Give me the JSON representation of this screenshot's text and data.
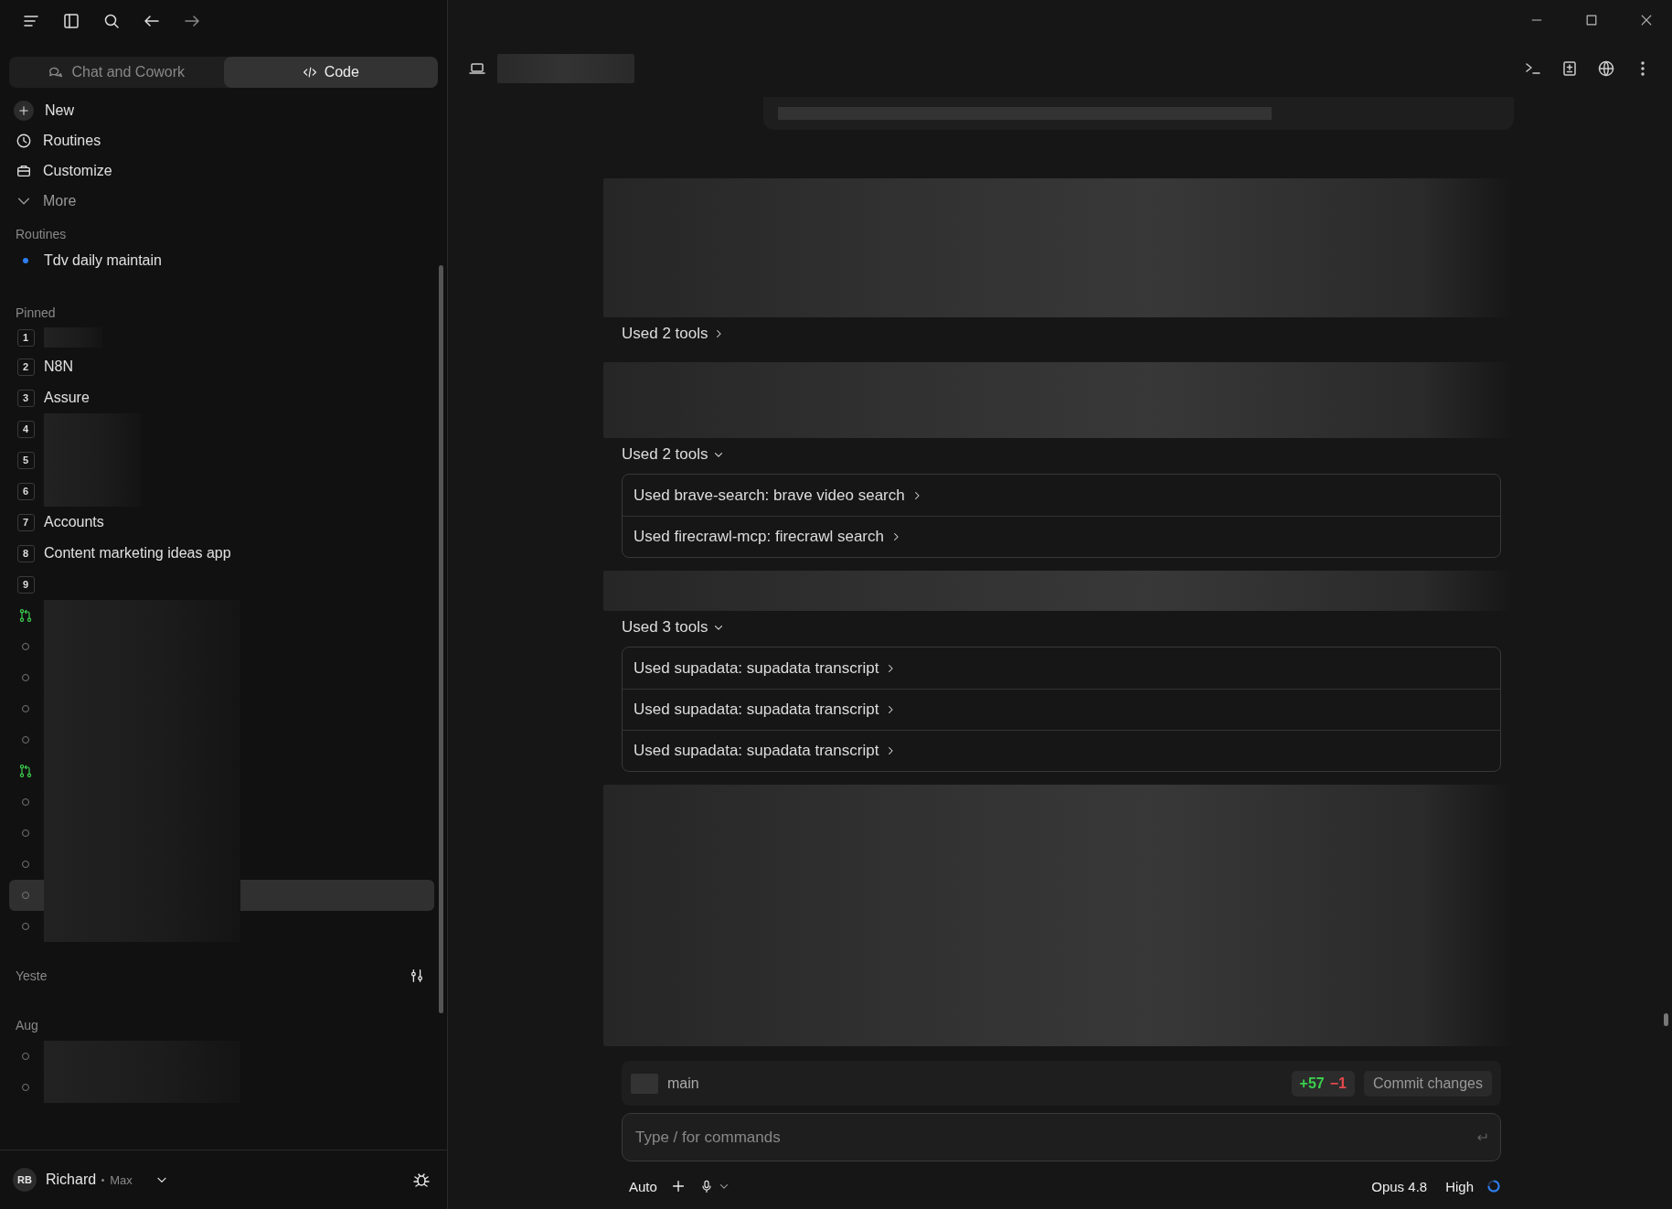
{
  "mode_tabs": [
    {
      "label": "Chat and Cowork",
      "kind": "chat",
      "selected": false
    },
    {
      "label": "Code",
      "kind": "code",
      "selected": true
    }
  ],
  "nav_items": [
    {
      "label": "New",
      "kind": "new"
    },
    {
      "label": "Routines",
      "kind": "routines"
    },
    {
      "label": "Customize",
      "kind": "customize"
    },
    {
      "label": "More",
      "kind": "more"
    }
  ],
  "routines": {
    "heading": "Routines",
    "items": [
      {
        "label": "Tdv daily maintain"
      }
    ]
  },
  "pinned": {
    "heading": "Pinned",
    "items": [
      {
        "number": "1"
      },
      {
        "number": "2",
        "label": "N8N"
      },
      {
        "number": "3",
        "label": "Assure"
      },
      {
        "number": "4"
      },
      {
        "number": "5"
      },
      {
        "number": "6"
      },
      {
        "number": "7",
        "label": "Accounts"
      },
      {
        "number": "8",
        "label": "Content marketing ideas app"
      },
      {
        "number": "9"
      }
    ]
  },
  "sessions": [
    {
      "kind": "pull-request",
      "selected": false
    },
    {
      "kind": "idle",
      "selected": false
    },
    {
      "kind": "idle",
      "selected": false
    },
    {
      "kind": "idle",
      "selected": false
    },
    {
      "kind": "idle",
      "selected": false
    },
    {
      "kind": "pull-request",
      "selected": false
    },
    {
      "kind": "idle",
      "selected": false
    },
    {
      "kind": "idle",
      "selected": false
    },
    {
      "kind": "idle",
      "selected": false
    },
    {
      "kind": "idle",
      "selected": true
    },
    {
      "kind": "idle",
      "selected": false
    }
  ],
  "groups": [
    {
      "heading": "Yeste",
      "filter": true
    },
    {
      "heading": "Aug",
      "filter": false,
      "sessions": [
        {
          "kind": "idle",
          "selected": false
        },
        {
          "kind": "idle",
          "selected": false
        }
      ]
    }
  ],
  "user": {
    "initials": "RB",
    "name": "Richard",
    "plan": "Max"
  },
  "transcript": [
    {
      "kind": "blur"
    },
    {
      "kind": "tools",
      "label": "Used 2 tools",
      "expanded": false
    },
    {
      "kind": "blur"
    },
    {
      "kind": "tools",
      "label": "Used 2 tools",
      "expanded": true,
      "tools": [
        "Used brave-search: brave video search",
        "Used firecrawl-mcp: firecrawl search"
      ]
    },
    {
      "kind": "blur"
    },
    {
      "kind": "tools",
      "label": "Used 3 tools",
      "expanded": true,
      "tools": [
        "Used supadata: supadata transcript",
        "Used supadata: supadata transcript",
        "Used supadata: supadata transcript"
      ]
    },
    {
      "kind": "blur"
    }
  ],
  "branch": {
    "name": "main",
    "additions": "+57",
    "deletions": "−1",
    "commit_button": "Commit changes"
  },
  "composer": {
    "placeholder": "Type / for commands",
    "mode": "Auto",
    "model": "Opus 4.8",
    "effort": "High"
  }
}
